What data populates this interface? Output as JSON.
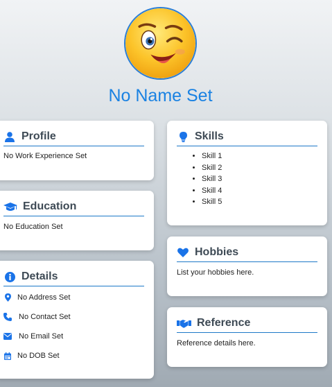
{
  "profile_name": "No Name Set",
  "colors": {
    "accent": "#1a82e2",
    "heading": "#3e4a55",
    "icon": "#1a73e8"
  },
  "avatar": {
    "icon": "winking-emoji-icon"
  },
  "cards": {
    "profile": {
      "title": "Profile",
      "icon": "user-icon",
      "text": "No Work Experience Set"
    },
    "education": {
      "title": "Education",
      "icon": "graduation-cap-icon",
      "text": "No Education Set"
    },
    "details": {
      "title": "Details",
      "icon": "info-icon",
      "rows": [
        {
          "icon": "map-pin-icon",
          "text": "No Address Set"
        },
        {
          "icon": "phone-icon",
          "text": "No Contact Set"
        },
        {
          "icon": "envelope-icon",
          "text": "No Email Set"
        },
        {
          "icon": "calendar-icon",
          "text": "No DOB Set"
        }
      ]
    },
    "skills": {
      "title": "Skills",
      "icon": "lightbulb-icon",
      "items": [
        "Skill 1",
        "Skill 2",
        "Skill 3",
        "Skill 4",
        "Skill 5"
      ]
    },
    "hobbies": {
      "title": "Hobbies",
      "icon": "heart-icon",
      "text": "List your hobbies here."
    },
    "reference": {
      "title": "Reference",
      "icon": "handshake-icon",
      "text": "Reference details here."
    }
  }
}
